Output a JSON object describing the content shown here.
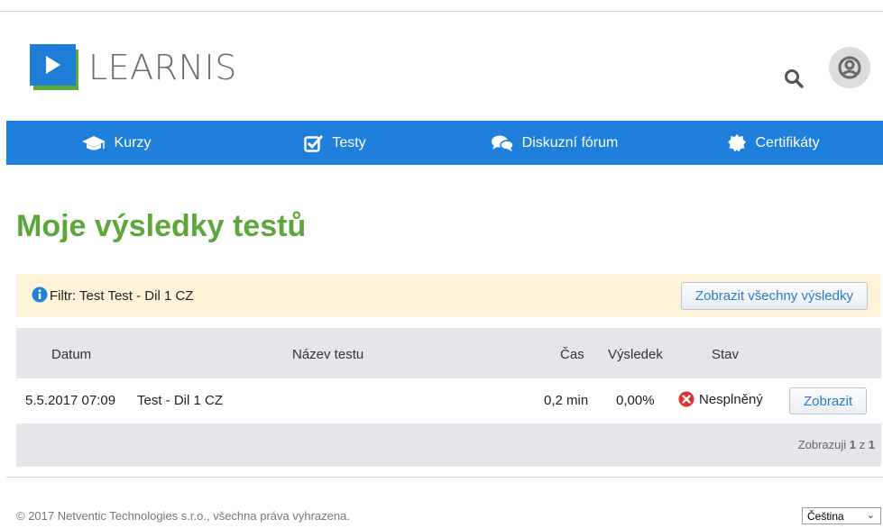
{
  "brand": {
    "name": "LEARNIS"
  },
  "nav": {
    "items": [
      {
        "label": "Kurzy",
        "icon": "graduation-cap-icon"
      },
      {
        "label": "Testy",
        "icon": "checkbox-icon"
      },
      {
        "label": "Diskuzní fórum",
        "icon": "chat-bubbles-icon"
      },
      {
        "label": "Certifikáty",
        "icon": "certificate-icon"
      }
    ]
  },
  "page": {
    "title": "Moje výsledky testů"
  },
  "filter": {
    "text": "Filtr: Test Test - Dil 1 CZ",
    "show_all_label": "Zobrazit všechny výsledky"
  },
  "table": {
    "columns": {
      "date": "Datum",
      "name": "Název testu",
      "time": "Čas",
      "result": "Výsledek",
      "status": "Stav"
    },
    "rows": [
      {
        "date": "5.5.2017 07:09",
        "name": "Test - Dil 1 CZ",
        "time": "0,2 min",
        "result": "0,00%",
        "status": "Nesplněný",
        "action": "Zobrazit"
      }
    ],
    "pager": {
      "prefix": "Zobrazuji",
      "current": "1",
      "sep": "z",
      "total": "1"
    }
  },
  "footer": {
    "copyright": "© 2017 Netventic Technologies s.r.o., všechna práva vyhrazena.",
    "language": "Čeština"
  },
  "colors": {
    "brand_blue": "#1f80dc",
    "title_green": "#5da63b",
    "filter_bg": "#fdf3d8",
    "fail_red": "#e03131"
  }
}
